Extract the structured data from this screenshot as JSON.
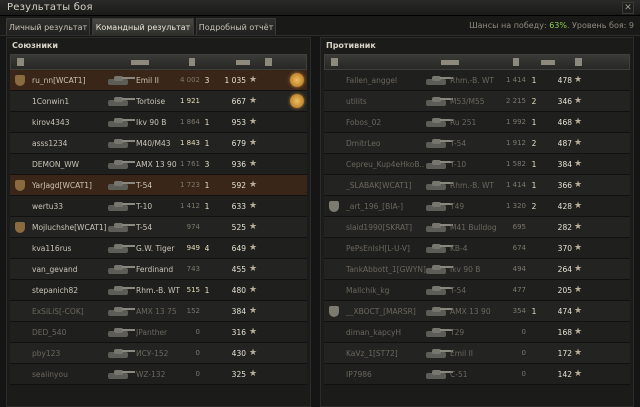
{
  "window": {
    "title": "Результаты боя",
    "close": "✕"
  },
  "tabs": [
    {
      "label": "Личный результат",
      "active": false
    },
    {
      "label": "Командный результат",
      "active": true
    },
    {
      "label": "Подробный отчёт",
      "active": false
    }
  ],
  "chance": {
    "prefix": "Шансы на победу: ",
    "pct": "63%",
    "suffix": ". Уровень боя: 9"
  },
  "allies": {
    "title": "Союзники",
    "rows": [
      {
        "name": "ru_nn[WCAT1]",
        "tank": "Emil II",
        "dmg": "4 002",
        "kills": "3",
        "xp": "1 035",
        "platoon": "brown",
        "medal": true,
        "me": true
      },
      {
        "name": "1Conwin1",
        "tank": "Tortoise",
        "dmg": "1 921",
        "kills": "",
        "xp": "667",
        "medal": true,
        "dmghi": true
      },
      {
        "name": "kirov4343",
        "tank": "Ikv 90 B",
        "dmg": "1 864",
        "kills": "1",
        "xp": "953"
      },
      {
        "name": "asss1234",
        "tank": "M40/M43",
        "dmg": "1 843",
        "kills": "1",
        "xp": "679",
        "dmghi": true
      },
      {
        "name": "DEMON_WW",
        "tank": "AMX 13 90",
        "dmg": "1 761",
        "kills": "3",
        "xp": "936"
      },
      {
        "name": "YarJagd[WCAT1]",
        "tank": "T-54",
        "dmg": "1 723",
        "kills": "1",
        "xp": "592",
        "platoon": "brown",
        "me": true
      },
      {
        "name": "wertu33",
        "tank": "T-10",
        "dmg": "1 412",
        "kills": "1",
        "xp": "633"
      },
      {
        "name": "Mojluchshe[WCAT1]",
        "tank": "T-54",
        "dmg": "974",
        "kills": "",
        "xp": "525",
        "platoon": "brown"
      },
      {
        "name": "kva116rus",
        "tank": "G.W. Tiger",
        "dmg": "949",
        "kills": "4",
        "xp": "649",
        "dmghi": true
      },
      {
        "name": "van_gevand",
        "tank": "Ferdinand",
        "dmg": "743",
        "kills": "",
        "xp": "455"
      },
      {
        "name": "stepanich82",
        "tank": "Rhm.-B. WT",
        "dmg": "515",
        "kills": "1",
        "xp": "480",
        "dmghi": true
      },
      {
        "name": "ExSiLiS[-COK]",
        "tank": "AMX 13 75",
        "dmg": "152",
        "kills": "",
        "xp": "384",
        "dead": true
      },
      {
        "name": "DED_540",
        "tank": "JPanther",
        "dmg": "0",
        "kills": "",
        "xp": "316",
        "dead": true
      },
      {
        "name": "pby123",
        "tank": "ИСУ-152",
        "dmg": "0",
        "kills": "",
        "xp": "430",
        "dead": true
      },
      {
        "name": "sealinyou",
        "tank": "WZ-132",
        "dmg": "0",
        "kills": "",
        "xp": "325",
        "dead": true
      }
    ]
  },
  "enemies": {
    "title": "Противник",
    "rows": [
      {
        "name": "Fallen_anggel",
        "tank": "Rhm.-B. WT",
        "dmg": "1 414",
        "kills": "1",
        "xp": "478",
        "dead": true
      },
      {
        "name": "utilits",
        "tank": "M53/M55",
        "dmg": "2 215",
        "kills": "2",
        "xp": "346",
        "dead": true
      },
      {
        "name": "Fobos_02",
        "tank": "Ru 251",
        "dmg": "1 992",
        "kills": "1",
        "xp": "468",
        "dead": true
      },
      {
        "name": "DmitrLeo",
        "tank": "T-54",
        "dmg": "1 912",
        "kills": "2",
        "xp": "487",
        "dead": true
      },
      {
        "name": "Cepreu_Kup4eHkoB..",
        "tank": "T-10",
        "dmg": "1 582",
        "kills": "1",
        "xp": "384",
        "dead": true
      },
      {
        "name": "_SLABAK[WCAT1]",
        "tank": "Rhm.-B. WT",
        "dmg": "1 414",
        "kills": "1",
        "xp": "366",
        "dead": true
      },
      {
        "name": "_art_196_[BIA-]",
        "tank": "T49",
        "dmg": "1 320",
        "kills": "2",
        "xp": "428",
        "platoon": "grey",
        "dead": true
      },
      {
        "name": "slaid1990[SKRAT]",
        "tank": "M41 Bulldog",
        "dmg": "695",
        "kills": "",
        "xp": "282",
        "dead": true
      },
      {
        "name": "PePsEnIsH[L-U-V]",
        "tank": "KB-4",
        "dmg": "674",
        "kills": "",
        "xp": "370",
        "dead": true
      },
      {
        "name": "TankAbbott_1[GWYN]",
        "tank": "Ikv 90 B",
        "dmg": "494",
        "kills": "",
        "xp": "264",
        "dead": true
      },
      {
        "name": "Mallchik_kg",
        "tank": "T-54",
        "dmg": "477",
        "kills": "",
        "xp": "205",
        "dead": true
      },
      {
        "name": "__XBOCT_[MARSR]",
        "tank": "AMX 13 90",
        "dmg": "354",
        "kills": "1",
        "xp": "474",
        "platoon": "grey",
        "dead": true
      },
      {
        "name": "diman_kapcyH",
        "tank": "T29",
        "dmg": "0",
        "kills": "",
        "xp": "168",
        "dead": true
      },
      {
        "name": "KaVz_1[ST72]",
        "tank": "Emil II",
        "dmg": "0",
        "kills": "",
        "xp": "172",
        "dead": true
      },
      {
        "name": "IP7986",
        "tank": "C-51",
        "dmg": "0",
        "kills": "",
        "xp": "142",
        "dead": true
      }
    ]
  },
  "icons": {
    "star": "★",
    "platoon": "platoon-shield-icon",
    "medal": "medal-icon",
    "tank": "tank-icon"
  }
}
